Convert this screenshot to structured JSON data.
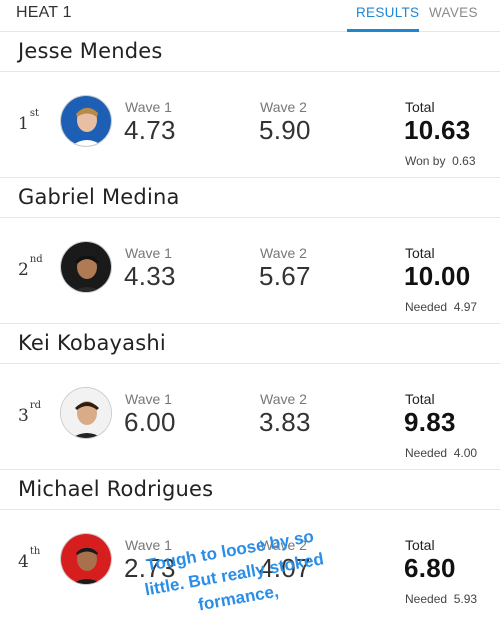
{
  "header": {
    "title": "HEAT 1",
    "tabs": [
      {
        "label": "RESULTS",
        "active": true
      },
      {
        "label": "WAVES",
        "active": false
      }
    ],
    "accent_color": "#1f86d0"
  },
  "results": [
    {
      "name": "Jesse Mendes",
      "place_num": "1",
      "place_suffix": "st",
      "wave1_label": "Wave 1",
      "wave1": "4.73",
      "wave2_label": "Wave 2",
      "wave2": "5.90",
      "total_label": "Total",
      "total": "10.63",
      "diff_label": "Won by",
      "diff_value": "0.63",
      "avatar_bg": "#1d5fb4"
    },
    {
      "name": "Gabriel Medina",
      "place_num": "2",
      "place_suffix": "nd",
      "wave1_label": "Wave 1",
      "wave1": "4.33",
      "wave2_label": "Wave 2",
      "wave2": "5.67",
      "total_label": "Total",
      "total": "10.00",
      "diff_label": "Needed",
      "diff_value": "4.97",
      "avatar_bg": "#1a1a1a"
    },
    {
      "name": "Kei Kobayashi",
      "place_num": "3",
      "place_suffix": "rd",
      "wave1_label": "Wave 1",
      "wave1": "6.00",
      "wave2_label": "Wave 2",
      "wave2": "3.83",
      "total_label": "Total",
      "total": "9.83",
      "diff_label": "Needed",
      "diff_value": "4.00",
      "avatar_bg": "#f2f2f2"
    },
    {
      "name": "Michael Rodrigues",
      "place_num": "4",
      "place_suffix": "th",
      "wave1_label": "Wave 1",
      "wave1": "2.73",
      "wave2_label": "Wave 2",
      "wave2": "4.07",
      "total_label": "Total",
      "total": "6.80",
      "diff_label": "Needed",
      "diff_value": "5.93",
      "avatar_bg": "#d71e1e"
    }
  ],
  "overlay_text": {
    "line1": "Tough to loose by so",
    "line2": "little. But really stoked",
    "line3": "formance,"
  }
}
